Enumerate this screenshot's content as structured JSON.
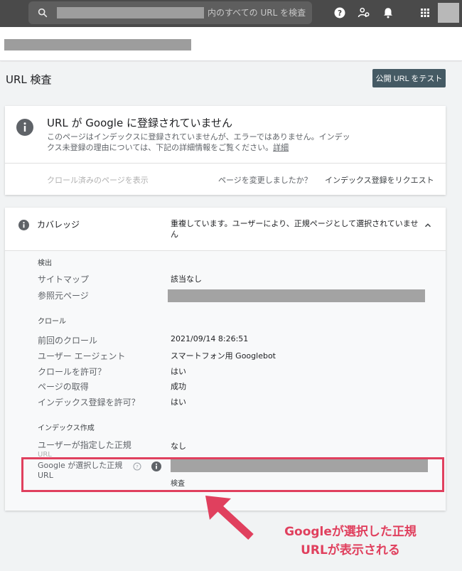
{
  "search": {
    "placeholder": "内のすべての URL を検査"
  },
  "icons": {
    "search": "search-icon",
    "help": "help-icon",
    "user_settings": "user-settings-icon",
    "notifications": "bell-icon",
    "apps": "apps-grid-icon"
  },
  "page": {
    "title": "URL 検査",
    "test_button": "公開 URL をテスト"
  },
  "status": {
    "title": "URL が Google に登録されていません",
    "description": "このページはインデックスに登録されていませんが、エラーではありません。インデックス未登録の理由については、下記の詳細情報をご覧ください。",
    "details_link": "詳細",
    "view_crawled": "クロール済みのページを表示",
    "changed_question": "ページを変更しましたか？",
    "request_indexing": "インデックス登録をリクエスト"
  },
  "coverage": {
    "label": "カバレッジ",
    "value": "重複しています。ユーザーにより、正規ページとして選択されていません",
    "discovery": {
      "heading": "検出",
      "sitemap_label": "サイトマップ",
      "sitemap_value": "該当なし",
      "referring_label": "参照元ページ"
    },
    "crawl": {
      "heading": "クロール",
      "last_crawl_label": "前回のクロール",
      "last_crawl_value": "2021/09/14 8:26:51",
      "user_agent_label": "ユーザー エージェント",
      "user_agent_value": "スマートフォン用 Googlebot",
      "crawl_allowed_label": "クロールを許可？",
      "crawl_allowed_value": "はい",
      "page_fetch_label": "ページの取得",
      "page_fetch_value": "成功",
      "indexing_allowed_label": "インデックス登録を許可？",
      "indexing_allowed_value": "はい"
    },
    "indexing": {
      "heading": "インデックス作成",
      "user_canonical_label": "ユーザーが指定した正規",
      "user_canonical_label2": "URL",
      "user_canonical_value": "なし",
      "google_canonical_label": "Google が選択した正規",
      "google_canonical_label2": "URL",
      "inspect_link": "検査"
    }
  },
  "annotation": {
    "line1": "Googleが選択した正規",
    "line2": "URLが表示される",
    "color": "#e0405e"
  }
}
